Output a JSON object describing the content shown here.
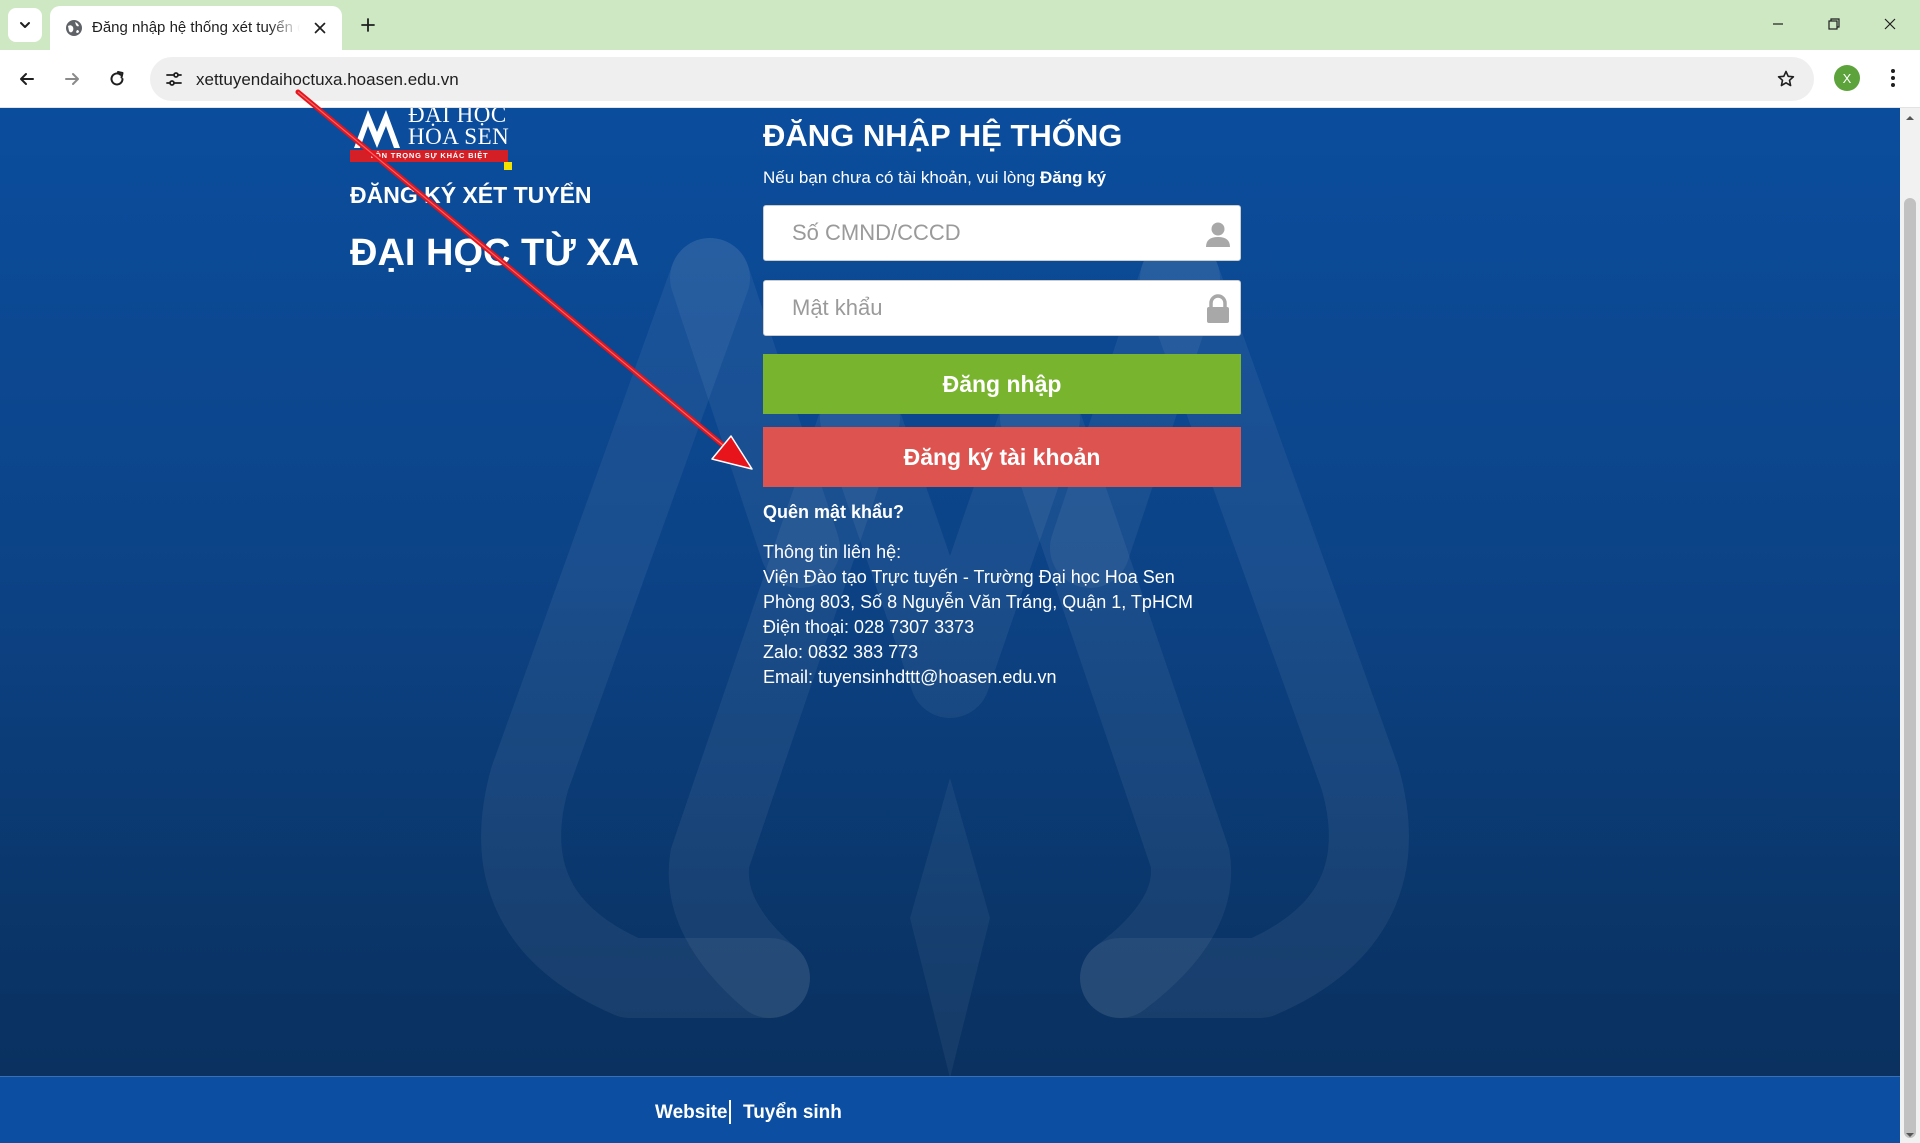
{
  "browser": {
    "tab_title": "Đăng nhập hệ thống xét tuyển đại học từ xa",
    "url": "xettuyendaihoctuxa.hoasen.edu.vn",
    "profile_initial": "X"
  },
  "brand": {
    "name_line1": "ĐẠI HỌC",
    "name_line2": "HOA SEN",
    "slogan": "TÔN TRỌNG SỰ KHÁC BIỆT",
    "heading_register": "ĐĂNG KÝ XÉT TUYỂN",
    "heading_program": "ĐẠI HỌC TỪ XA"
  },
  "login": {
    "title": "ĐĂNG NHẬP HỆ THỐNG",
    "subtitle_prefix": "Nếu bạn chưa có tài khoản, vui lòng",
    "subtitle_link": "Đăng ký",
    "id_placeholder": "Số CMND/CCCD",
    "password_placeholder": "Mật khẩu",
    "login_button": "Đăng nhập",
    "register_button": "Đăng ký tài khoản",
    "forgot_password": "Quên mật khẩu?"
  },
  "contact": {
    "heading": "Thông tin liên hệ:",
    "institute": "Viện Đào tạo Trực tuyến - Trường Đại học Hoa Sen",
    "address": "Phòng 803, Số 8 Nguyễn Văn Tráng, Quận 1, TpHCM",
    "phone": "Điện thoại: 028 7307 3373",
    "zalo": "Zalo: 0832 383 773",
    "email": "Email: tuyensinhdttt@hoasen.edu.vn"
  },
  "footer": {
    "website": "Website",
    "admissions": "Tuyển sinh"
  },
  "colors": {
    "login_button": "#78b42d",
    "register_button": "#dc5350",
    "background": "#0c4386",
    "annotation_arrow": "#e8141b"
  },
  "icons": {
    "id_field": "user-icon",
    "password_field": "lock-icon"
  }
}
